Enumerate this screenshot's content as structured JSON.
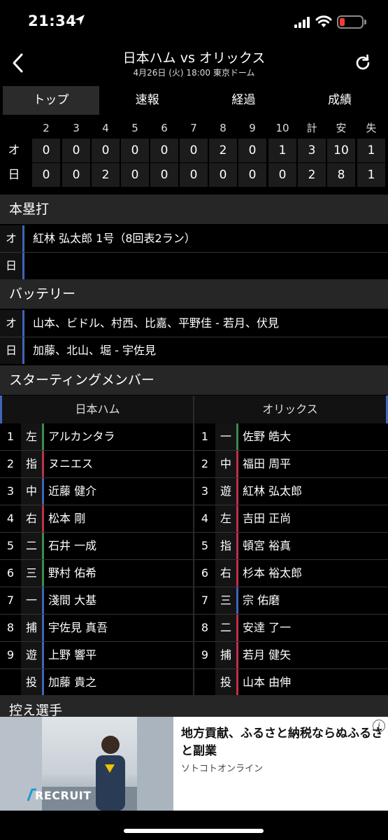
{
  "status": {
    "time": "21:34"
  },
  "header": {
    "title": "日本ハム vs オリックス",
    "subtitle": "4月26日 (火) 18:00 東京ドーム"
  },
  "tabs": [
    "トップ",
    "速報",
    "経過",
    "成績"
  ],
  "scoreboard": {
    "columns": [
      "2",
      "3",
      "4",
      "5",
      "6",
      "7",
      "8",
      "9",
      "10",
      "計",
      "安",
      "失"
    ],
    "rows": [
      {
        "team": "オ",
        "values": [
          "0",
          "0",
          "0",
          "0",
          "0",
          "0",
          "2",
          "0",
          "1",
          "3",
          "10",
          "1"
        ]
      },
      {
        "team": "日",
        "values": [
          "0",
          "0",
          "2",
          "0",
          "0",
          "0",
          "0",
          "0",
          "0",
          "2",
          "8",
          "1"
        ]
      }
    ]
  },
  "homeruns": {
    "title": "本塁打",
    "rows": [
      {
        "team": "オ",
        "text": "紅林 弘太郎 1号（8回表2ラン）"
      },
      {
        "team": "日",
        "text": ""
      }
    ]
  },
  "battery": {
    "title": "バッテリー",
    "rows": [
      {
        "team": "オ",
        "text": "山本、ビドル、村西、比嘉、平野佳 - 若月、伏見"
      },
      {
        "team": "日",
        "text": "加藤、北山、堀 - 宇佐見"
      }
    ]
  },
  "starting": {
    "title": "スターティングメンバー",
    "home_team": "日本ハム",
    "away_team": "オリックス",
    "home": [
      {
        "no": "1",
        "pos": "左",
        "name": "アルカンタラ"
      },
      {
        "no": "2",
        "pos": "指",
        "name": "ヌニエス"
      },
      {
        "no": "3",
        "pos": "中",
        "name": "近藤 健介"
      },
      {
        "no": "4",
        "pos": "右",
        "name": "松本 剛"
      },
      {
        "no": "5",
        "pos": "二",
        "name": "石井 一成"
      },
      {
        "no": "6",
        "pos": "三",
        "name": "野村 佑希"
      },
      {
        "no": "7",
        "pos": "一",
        "name": "淺間 大基"
      },
      {
        "no": "8",
        "pos": "捕",
        "name": "宇佐見 真吾"
      },
      {
        "no": "9",
        "pos": "遊",
        "name": "上野 響平"
      },
      {
        "no": "",
        "pos": "投",
        "name": "加藤 貴之"
      }
    ],
    "away": [
      {
        "no": "1",
        "pos": "一",
        "name": "佐野 皓大"
      },
      {
        "no": "2",
        "pos": "中",
        "name": "福田 周平"
      },
      {
        "no": "3",
        "pos": "遊",
        "name": "紅林 弘太郎"
      },
      {
        "no": "4",
        "pos": "左",
        "name": "吉田 正尚"
      },
      {
        "no": "5",
        "pos": "指",
        "name": "頓宮 裕真"
      },
      {
        "no": "6",
        "pos": "右",
        "name": "杉本 裕太郎"
      },
      {
        "no": "7",
        "pos": "三",
        "name": "宗 佑磨"
      },
      {
        "no": "8",
        "pos": "二",
        "name": "安達 了一"
      },
      {
        "no": "9",
        "pos": "捕",
        "name": "若月 健矢"
      },
      {
        "no": "",
        "pos": "投",
        "name": "山本 由伸"
      }
    ]
  },
  "bench": {
    "title": "控え選手"
  },
  "ad": {
    "headline": "地方貢献、ふるさと納税ならぬふるさと副業",
    "sponsor": "ソトコトオンライン",
    "logo_text": "RECRUIT"
  },
  "colors": {
    "bar_green": "#3d8b4f",
    "bar_red": "#c0304a",
    "bar_blue": "#3f66b8",
    "battery_red": "#8c2b3c"
  }
}
